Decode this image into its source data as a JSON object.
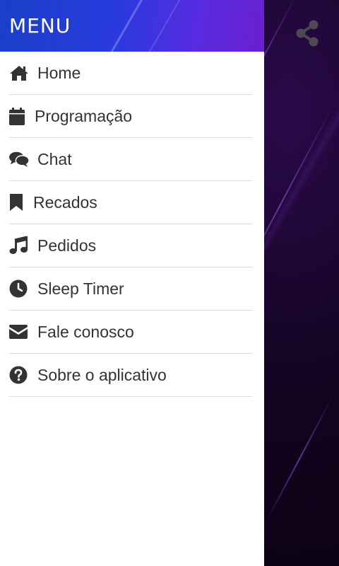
{
  "drawer": {
    "title": "MENU",
    "items": [
      {
        "label": "Home",
        "icon": "home-icon"
      },
      {
        "label": "Programação",
        "icon": "calendar-icon"
      },
      {
        "label": "Chat",
        "icon": "chat-icon"
      },
      {
        "label": "Recados",
        "icon": "bookmark-icon"
      },
      {
        "label": "Pedidos",
        "icon": "music-icon"
      },
      {
        "label": "Sleep Timer",
        "icon": "clock-icon"
      },
      {
        "label": "Fale conosco",
        "icon": "envelope-icon"
      },
      {
        "label": "Sobre o aplicativo",
        "icon": "question-icon"
      }
    ]
  },
  "app": {
    "share_icon": "share-icon"
  },
  "colors": {
    "header_start": "#1a3fc8",
    "header_end": "#6a1fcf",
    "icon": "#333333",
    "text": "#333333",
    "divider": "#dcdcdc",
    "background": "#0d0418"
  }
}
